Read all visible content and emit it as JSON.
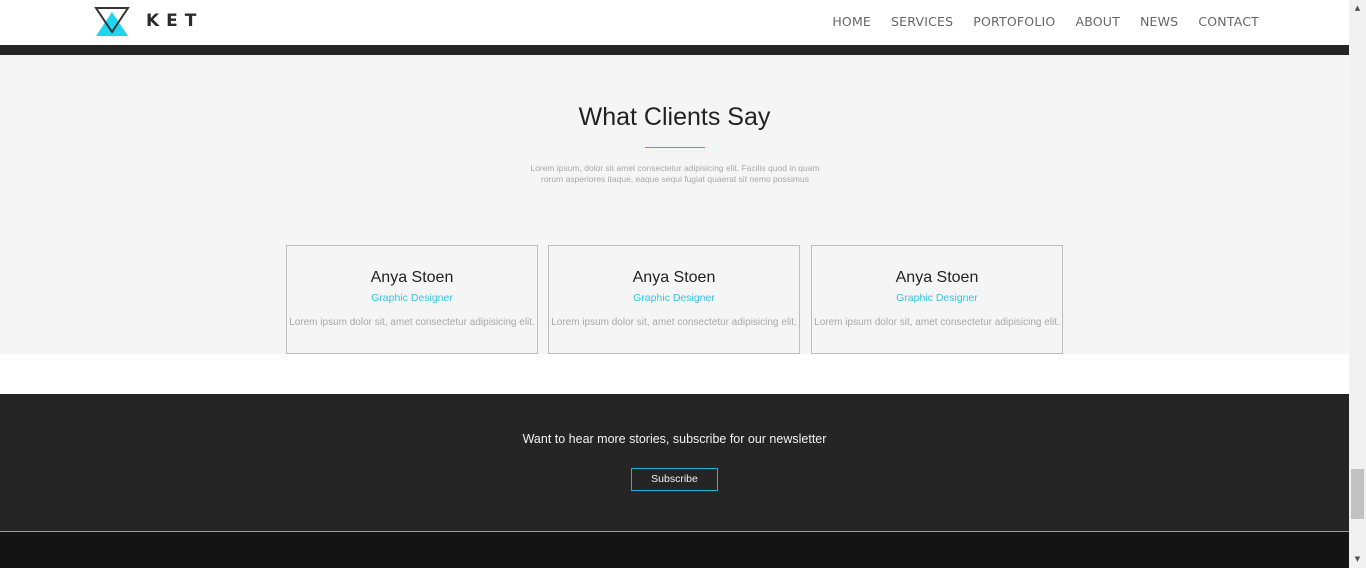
{
  "header": {
    "brand": "KET",
    "logo_icon": "triangle-logo-icon",
    "nav": [
      {
        "label": "HOME"
      },
      {
        "label": "SERVICES"
      },
      {
        "label": "PORTOFOLIO"
      },
      {
        "label": "ABOUT"
      },
      {
        "label": "NEWS"
      },
      {
        "label": "CONTACT"
      }
    ]
  },
  "testimonials": {
    "title": "What Clients Say",
    "intro": "Lorem ipsum, dolor sit amet consectetur adipisicing elit. Facilis quod in quam rorum asperiores itaque, eaque sequi fugiat quaerat sit nemo possimus",
    "cards": [
      {
        "name": "Anya Stoen",
        "role": "Graphic Designer",
        "quote": "Lorem ipsum dolor sit, amet consectetur adipisicing elit."
      },
      {
        "name": "Anya Stoen",
        "role": "Graphic Designer",
        "quote": "Lorem ipsum dolor sit, amet consectetur adipisicing elit."
      },
      {
        "name": "Anya Stoen",
        "role": "Graphic Designer",
        "quote": "Lorem ipsum dolor sit, amet consectetur adipisicing elit."
      }
    ]
  },
  "newsletter": {
    "text": "Want to hear more stories, subscribe for our newsletter",
    "button_label": "Subscribe"
  },
  "colors": {
    "accent": "#1fb6d5",
    "dark": "#252525",
    "light_bg": "#f5f5f5"
  }
}
